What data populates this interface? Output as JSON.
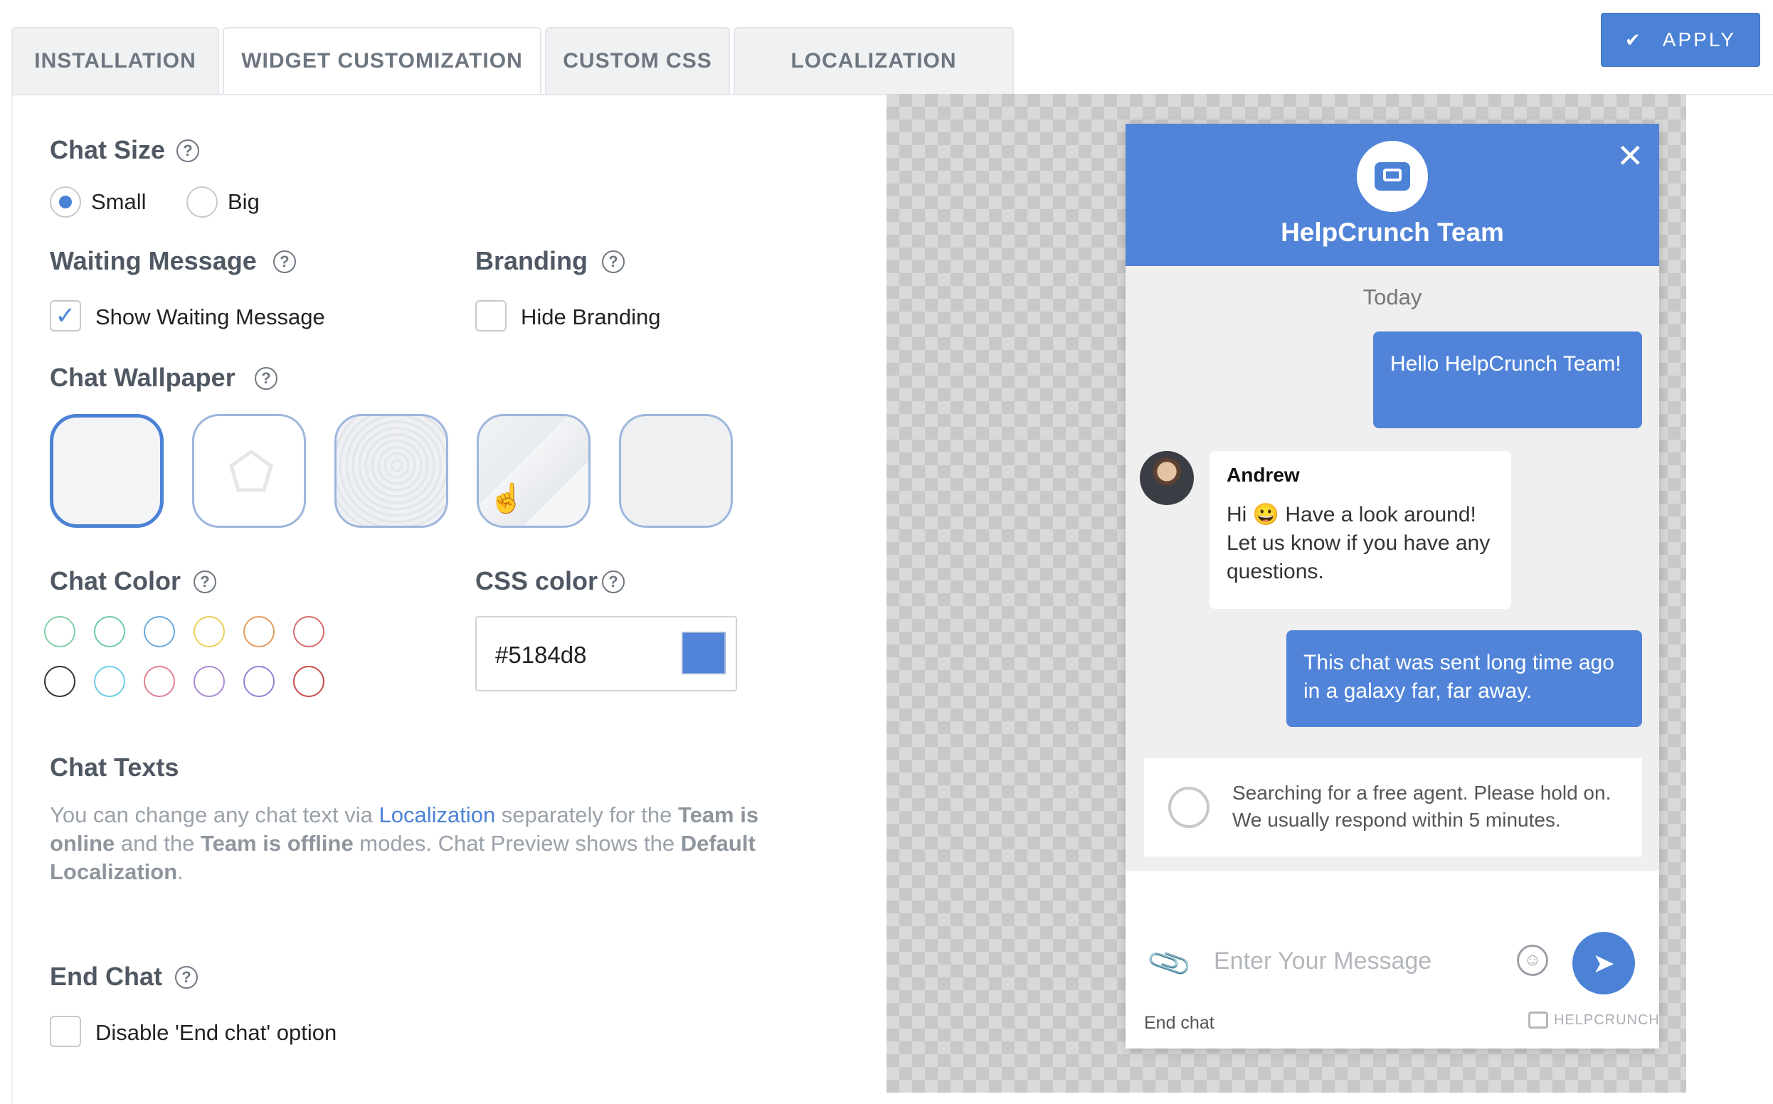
{
  "tabs": [
    {
      "label": "INSTALLATION"
    },
    {
      "label": "WIDGET CUSTOMIZATION"
    },
    {
      "label": "CUSTOM CSS"
    },
    {
      "label": "LOCALIZATION"
    }
  ],
  "apply": {
    "label": "APPLY",
    "icon": "check-icon"
  },
  "chat_size": {
    "title": "Chat Size",
    "options": [
      "Small",
      "Big"
    ],
    "selected": "Small"
  },
  "waiting": {
    "title": "Waiting Message",
    "option": "Show Waiting Message",
    "checked": true
  },
  "branding": {
    "title": "Branding",
    "option": "Hide Branding",
    "checked": false
  },
  "wallpaper": {
    "title": "Chat Wallpaper",
    "selected_index": 0
  },
  "chat_color": {
    "title": "Chat Color",
    "swatches": [
      "#7fcfa8",
      "#6ec8b0",
      "#6aa8d8",
      "#e8cf55",
      "#e29a5a",
      "#d86a6a",
      "#333333",
      "#6ccbe8",
      "#e27f93",
      "#a88ad0",
      "#8a86d6",
      "#c84a4a"
    ]
  },
  "css_color": {
    "title": "CSS color",
    "value": "#5184d8",
    "swatch": "#5184d8"
  },
  "chat_texts": {
    "title": "Chat Texts",
    "p1": "You can change any chat text via ",
    "link": "Localization",
    "p2": " separately for the ",
    "b1": "Team is online",
    "p3": " and the ",
    "b2": "Team is offline",
    "p4": " modes. Chat Preview shows the ",
    "b3": "Default Localization",
    "p5": "."
  },
  "end_chat": {
    "title": "End Chat",
    "option": "Disable 'End chat' option",
    "checked": false
  },
  "widget": {
    "header_title": "HelpCrunch Team",
    "day": "Today",
    "msg1": "Hello HelpCrunch Team!",
    "agent_name": "Andrew",
    "agent_msg": "Hi 😀  Have a look around! Let us know if you have any questions.",
    "msg3": "This chat was sent long time ago in a galaxy far, far away.",
    "searching": "Searching for a free agent. Please hold on.",
    "searching2": "We usually respond within 5 minutes.",
    "input_placeholder": "Enter Your Message",
    "end_chat": "End chat",
    "brand": "HELPCRUNCH",
    "accent": "#5184d8"
  }
}
